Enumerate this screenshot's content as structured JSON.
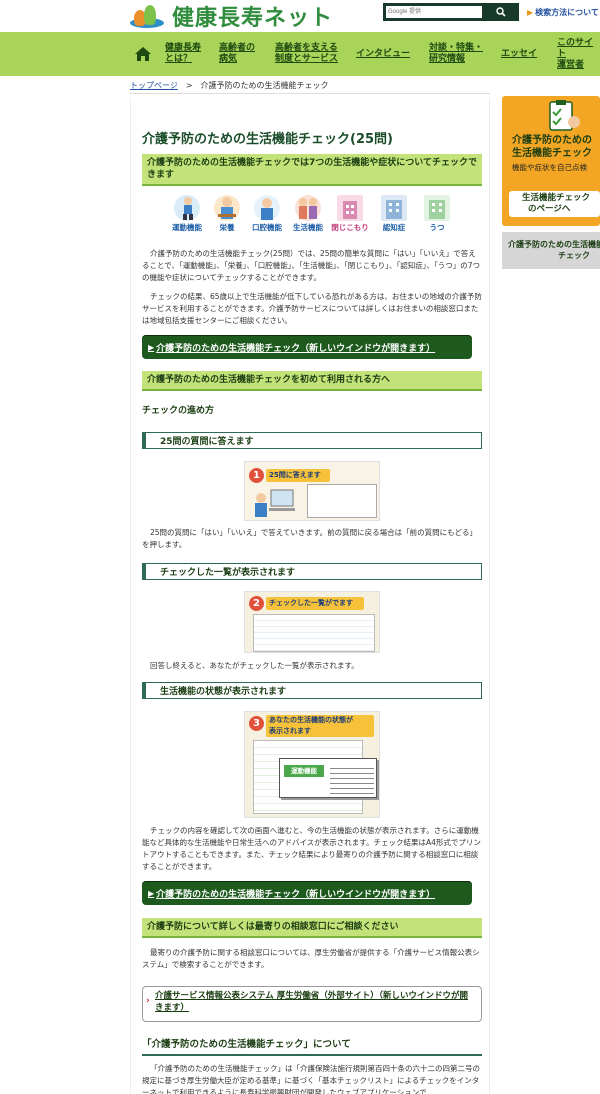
{
  "header": {
    "logo_text": "健康長寿ネット",
    "search_placeholder": "Google 提供",
    "search_help": "検索方法について"
  },
  "nav": {
    "items": [
      {
        "line1": "健康長寿",
        "line2": "とは？"
      },
      {
        "line1": "高齢者の",
        "line2": "病気"
      },
      {
        "line1": "高齢者を支える",
        "line2": "制度とサービス"
      },
      {
        "line1": "インタビュー",
        "line2": ""
      },
      {
        "line1": "対談・特集・",
        "line2": "研究情報"
      },
      {
        "line1": "エッセイ",
        "line2": ""
      },
      {
        "line1": "このサイト",
        "line2": "運営者"
      }
    ]
  },
  "breadcrumb": {
    "home": "トップページ",
    "sep": ">",
    "current": "介護予防のための生活機能チェック"
  },
  "main": {
    "title": "介護予防のための生活機能チェック(25問)",
    "intro_bar": "介護予防のための生活機能チェックでは7つの生活機能や症状についてチェックできます",
    "icons": [
      "運動機能",
      "栄養",
      "口腔機能",
      "生活機能",
      "閉じこもり",
      "認知症",
      "うつ"
    ],
    "para1": "介護予防のための生活機能チェック(25問）では、25問の簡単な質問に「はい」「いいえ」で答えることで、「運動機能」、「栄養」、「口腔機能」、「生活機能」、「閉じこもり」、「認知症」、「うつ」の7つの機能や症状についてチェックすることができます。",
    "para2": "チェックの結果、65歳以上で生活機能が低下している恐れがある方は、お住まいの地域の介護予防サービスを利用することができます。介護予防サービスについては詳しくはお住まいの相談窓口または地域包括支援センターにご相談ください。",
    "check_button": "介護予防のための生活機能チェック（新しいウインドウが開きます）",
    "first_time_bar": "介護予防のための生活機能チェックを初めて利用される方へ",
    "steps_heading": "チェックの進め方",
    "step1": {
      "heading": "25問の質問に答えます",
      "illus_label": "25問に答えます",
      "illus_num": "1",
      "text": "25問の質問に「はい」「いいえ」で答えていきます。前の質問に戻る場合は「前の質問にもどる」を押します。"
    },
    "step2": {
      "heading": "チェックした一覧が表示されます",
      "illus_label": "チェックした一覧がでます",
      "illus_num": "2",
      "text": "回答し終えると、あなたがチェックした一覧が表示されます。"
    },
    "step3": {
      "heading": "生活機能の状態が表示されます",
      "illus_label_1": "あなたの生活機能の状態が",
      "illus_label_2": "表示されます",
      "illus_num": "3",
      "illus_tag": "運動機能",
      "text": "チェックの内容を確認して次の画面へ進むと、今の生活機能の状態が表示されます。さらに運動機能など具体的な生活機能や日常生活へのアドバイスが表示されます。チェック結果はA4形式でプリントアウトすることもできます。また、チェック結果により最寄りの介護予防に関する相談窓口に相談することができます。"
    },
    "check_button_2": "介護予防のための生活機能チェック（新しいウインドウが開きます）",
    "consult_bar": "介護予防について詳しくは最寄りの相談窓口にご相談ください",
    "consult_text": "最寄りの介護予防に関する相談窓口については、厚生労働省が提供する「介護サービス情報公表システム」で検索することができます。",
    "consult_link": "介護サービス情報公表システム 厚生労働省（外部サイト）（新しいウインドウが開きます）",
    "about_heading": "「介護予防のための生活機能チェック」について",
    "about_text": "「介護予防のための生活機能チェック」は「介護保険法施行規則第百四十条の六十二の四第二号の規定に基づき厚生労働大臣が定める基準」に基づく「基本チェックリスト」によるチェックをインターネットで利用できるように長寿科学振興財団が開発したウェブアプリケーションで"
  },
  "side": {
    "title_line1": "介護予防のための",
    "title_line2": "生活機能チェック",
    "text": "機能や症状を自己点検",
    "button_line1": "生活機能チェック",
    "button_line2": "のページへ",
    "current_line1": "介護予防のための生活機能",
    "current_line2": "チェック"
  },
  "colors": {
    "nav_green": "#a8d45a",
    "bar_green": "#c4e27a",
    "dark_green": "#1e5a1e",
    "side_orange": "#f2a623",
    "logo_green": "#2f8d3d"
  }
}
